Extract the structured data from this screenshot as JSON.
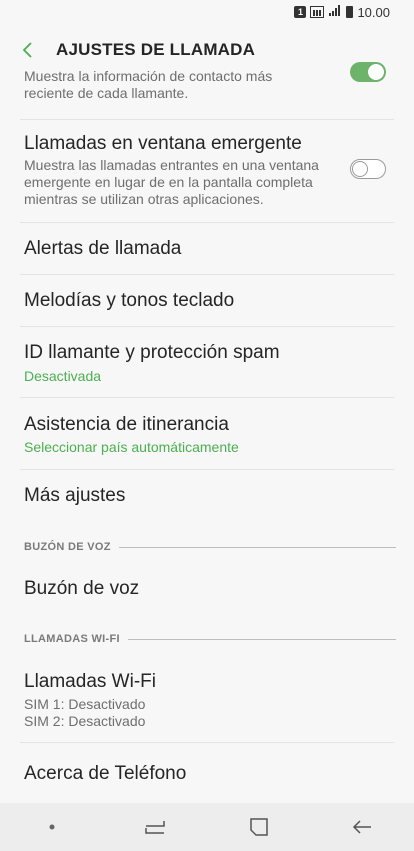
{
  "status": {
    "sim": "1",
    "time": "10.00"
  },
  "header": {
    "title": "AJUSTES DE LLAMADA"
  },
  "items": {
    "caller_info_sub": "Muestra la información de contacto más reciente de cada llamante.",
    "popup_title": "Llamadas en ventana emergente",
    "popup_sub": "Muestra las llamadas entrantes en una ventana emergente en lugar de en la pantalla completa mientras se utilizan otras aplicaciones.",
    "alerts": "Alertas de llamada",
    "ringtones": "Melodías y tonos teclado",
    "caller_id": "ID llamante y protección spam",
    "caller_id_status": "Desactivada",
    "roaming": "Asistencia de itinerancia",
    "roaming_status": "Seleccionar país automáticamente",
    "more": "Más ajustes",
    "voicemail_section": "BUZÓN DE VOZ",
    "voicemail": "Buzón de voz",
    "wifi_section": "LLAMADAS WI-FI",
    "wifi_calls": "Llamadas Wi-Fi",
    "wifi_sim1": "SIM 1: Desactivado",
    "wifi_sim2": "SIM 2: Desactivado",
    "about": "Acerca de Teléfono"
  },
  "toggles": {
    "caller_info": "on",
    "popup": "off"
  },
  "colors": {
    "accent": "#4caf50",
    "toggle_on": "#6db36a"
  },
  "icons": [
    "back-arrow-icon",
    "recents-icon",
    "home-icon",
    "back-icon"
  ]
}
